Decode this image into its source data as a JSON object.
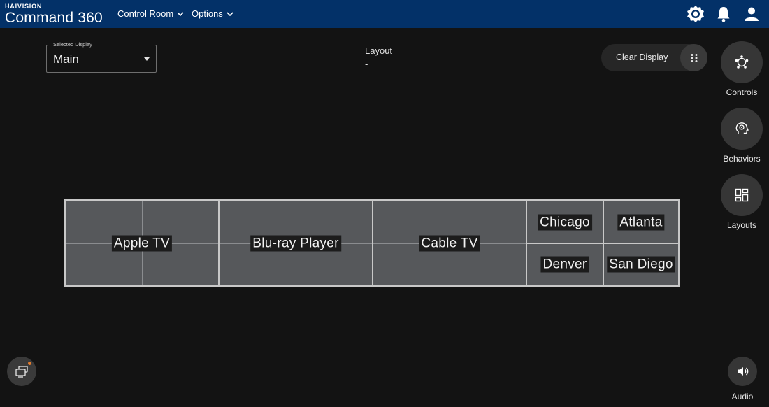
{
  "brand": {
    "company": "HAIVISION",
    "product": "Command 360"
  },
  "nav": {
    "control_room": "Control Room",
    "options": "Options"
  },
  "top_icons": [
    "settings-icon",
    "bell-icon",
    "user-icon"
  ],
  "selected_display": {
    "legend": "Selected Display",
    "value": "Main"
  },
  "layout": {
    "label": "Layout",
    "value": "-"
  },
  "clear_display": {
    "label": "Clear Display"
  },
  "side_buttons": {
    "controls": "Controls",
    "behaviors": "Behaviors",
    "layouts": "Layouts",
    "audio": "Audio"
  },
  "wall": {
    "screens": [
      {
        "label": "Apple TV"
      },
      {
        "label": "Blu-ray Player"
      },
      {
        "label": "Cable TV"
      },
      {
        "label": "Chicago"
      },
      {
        "label": "Atlanta"
      },
      {
        "label": "Denver"
      },
      {
        "label": "San Diego"
      }
    ]
  },
  "colors": {
    "topbar": "#033168",
    "background": "#131313",
    "tile": "#56585b",
    "notification_dot": "#e27b2d"
  }
}
